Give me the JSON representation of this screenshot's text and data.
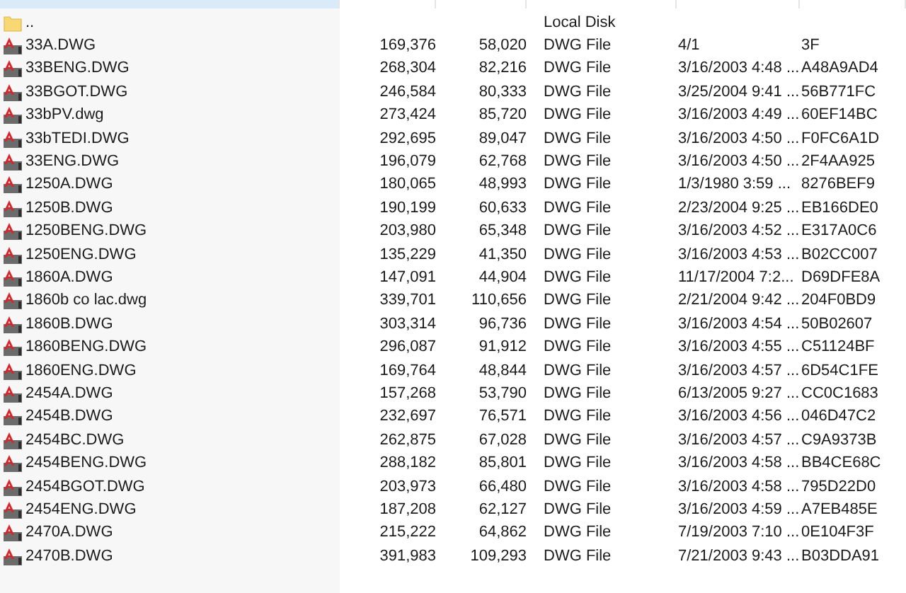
{
  "columns": [
    {
      "sorted": true
    },
    {
      "sorted": false
    },
    {
      "sorted": false
    },
    {
      "sorted": false
    },
    {
      "sorted": false
    },
    {
      "sorted": false
    }
  ],
  "rows": [
    {
      "kind": "folder",
      "name": "..",
      "size": "",
      "packed": "",
      "type": "Local Disk",
      "modified": "",
      "crc": ""
    },
    {
      "kind": "dwg",
      "name": "33A.DWG",
      "size": "169,376",
      "packed": "58,020",
      "type": "DWG File",
      "modified": "4/1",
      "crc": "3F"
    },
    {
      "kind": "dwg",
      "name": "33BENG.DWG",
      "size": "268,304",
      "packed": "82,216",
      "type": "DWG File",
      "modified": "3/16/2003 4:48 ...",
      "crc": "A48A9AD4"
    },
    {
      "kind": "dwg",
      "name": "33BGOT.DWG",
      "size": "246,584",
      "packed": "80,333",
      "type": "DWG File",
      "modified": "3/25/2004 9:41 ...",
      "crc": "56B771FC"
    },
    {
      "kind": "dwg",
      "name": "33bPV.dwg",
      "size": "273,424",
      "packed": "85,720",
      "type": "DWG File",
      "modified": "3/16/2003 4:49 ...",
      "crc": "60EF14BC"
    },
    {
      "kind": "dwg",
      "name": "33bTEDI.DWG",
      "size": "292,695",
      "packed": "89,047",
      "type": "DWG File",
      "modified": "3/16/2003 4:50 ...",
      "crc": "F0FC6A1D"
    },
    {
      "kind": "dwg",
      "name": "33ENG.DWG",
      "size": "196,079",
      "packed": "62,768",
      "type": "DWG File",
      "modified": "3/16/2003 4:50 ...",
      "crc": "2F4AA925"
    },
    {
      "kind": "dwg",
      "name": "1250A.DWG",
      "size": "180,065",
      "packed": "48,993",
      "type": "DWG File",
      "modified": "1/3/1980 3:59 ...",
      "crc": "8276BEF9"
    },
    {
      "kind": "dwg",
      "name": "1250B.DWG",
      "size": "190,199",
      "packed": "60,633",
      "type": "DWG File",
      "modified": "2/23/2004 9:25 ...",
      "crc": "EB166DE0"
    },
    {
      "kind": "dwg",
      "name": "1250BENG.DWG",
      "size": "203,980",
      "packed": "65,348",
      "type": "DWG File",
      "modified": "3/16/2003 4:52 ...",
      "crc": "E317A0C6"
    },
    {
      "kind": "dwg",
      "name": "1250ENG.DWG",
      "size": "135,229",
      "packed": "41,350",
      "type": "DWG File",
      "modified": "3/16/2003 4:53 ...",
      "crc": "B02CC007"
    },
    {
      "kind": "dwg",
      "name": "1860A.DWG",
      "size": "147,091",
      "packed": "44,904",
      "type": "DWG File",
      "modified": "11/17/2004 7:2...",
      "crc": "D69DFE8A"
    },
    {
      "kind": "dwg",
      "name": "1860b co lac.dwg",
      "size": "339,701",
      "packed": "110,656",
      "type": "DWG File",
      "modified": "2/21/2004 9:42 ...",
      "crc": "204F0BD9"
    },
    {
      "kind": "dwg",
      "name": "1860B.DWG",
      "size": "303,314",
      "packed": "96,736",
      "type": "DWG File",
      "modified": "3/16/2003 4:54 ...",
      "crc": "50B02607"
    },
    {
      "kind": "dwg",
      "name": "1860BENG.DWG",
      "size": "296,087",
      "packed": "91,912",
      "type": "DWG File",
      "modified": "3/16/2003 4:55 ...",
      "crc": "C51124BF"
    },
    {
      "kind": "dwg",
      "name": "1860ENG.DWG",
      "size": "169,764",
      "packed": "48,844",
      "type": "DWG File",
      "modified": "3/16/2003 4:57 ...",
      "crc": "6D54C1FE"
    },
    {
      "kind": "dwg",
      "name": "2454A.DWG",
      "size": "157,268",
      "packed": "53,790",
      "type": "DWG File",
      "modified": "6/13/2005 9:27 ...",
      "crc": "CC0C1683"
    },
    {
      "kind": "dwg",
      "name": "2454B.DWG",
      "size": "232,697",
      "packed": "76,571",
      "type": "DWG File",
      "modified": "3/16/2003 4:56 ...",
      "crc": "046D47C2"
    },
    {
      "kind": "dwg",
      "name": "2454BC.DWG",
      "size": "262,875",
      "packed": "67,028",
      "type": "DWG File",
      "modified": "3/16/2003 4:57 ...",
      "crc": "C9A9373B"
    },
    {
      "kind": "dwg",
      "name": "2454BENG.DWG",
      "size": "288,182",
      "packed": "85,801",
      "type": "DWG File",
      "modified": "3/16/2003 4:58 ...",
      "crc": "BB4CE68C"
    },
    {
      "kind": "dwg",
      "name": "2454BGOT.DWG",
      "size": "203,973",
      "packed": "66,480",
      "type": "DWG File",
      "modified": "3/16/2003 4:58 ...",
      "crc": "795D22D0"
    },
    {
      "kind": "dwg",
      "name": "2454ENG.DWG",
      "size": "187,208",
      "packed": "62,127",
      "type": "DWG File",
      "modified": "3/16/2003 4:59 ...",
      "crc": "A7EB485E"
    },
    {
      "kind": "dwg",
      "name": "2470A.DWG",
      "size": "215,222",
      "packed": "64,862",
      "type": "DWG File",
      "modified": "7/19/2003 7:10 ...",
      "crc": "0E104F3F"
    },
    {
      "kind": "dwg",
      "name": "2470B.DWG",
      "size": "391,983",
      "packed": "109,293",
      "type": "DWG File",
      "modified": "7/21/2003 9:43 ...",
      "crc": "B03DDA91"
    }
  ]
}
